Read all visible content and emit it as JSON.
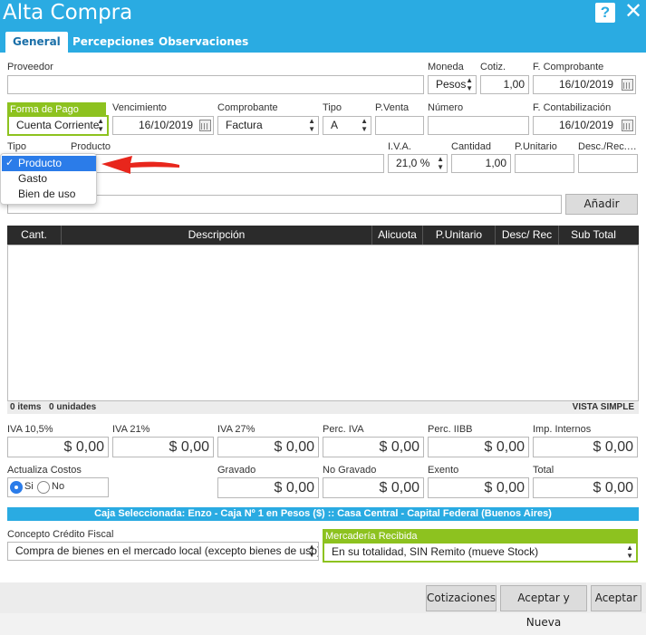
{
  "window": {
    "title": "Alta Compra",
    "help": "?",
    "close": "✕"
  },
  "tabs": [
    {
      "label": "General"
    },
    {
      "label": "Percepciones"
    },
    {
      "label": "Observaciones"
    }
  ],
  "row1": {
    "proveedor_label": "Proveedor",
    "moneda_label": "Moneda",
    "moneda_value": "Pesos",
    "cotiz_label": "Cotiz.",
    "cotiz_value": "1,00",
    "fcomp_label": "F. Comprobante",
    "fcomp_value": "16/10/2019"
  },
  "row2": {
    "forma_pago_label": "Forma de Pago",
    "forma_pago_value": "Cuenta Corriente",
    "vencimiento_label": "Vencimiento",
    "vencimiento_value": "16/10/2019",
    "comprobante_label": "Comprobante",
    "comprobante_value": "Factura",
    "tipo_label": "Tipo",
    "tipo_value": "A",
    "pventa_label": "P.Venta",
    "numero_label": "Número",
    "fcontab_label": "F. Contabilización",
    "fcontab_value": "16/10/2019"
  },
  "row3": {
    "tipo_label": "Tipo",
    "producto_label": "Producto",
    "iva_label": "I.V.A.",
    "iva_value": "21,0 %",
    "cantidad_label": "Cantidad",
    "cantidad_value": "1,00",
    "punitario_label": "P.Unitario",
    "descrec_label": "Desc./Rec.…"
  },
  "tipo_dropdown": {
    "options": [
      "Producto",
      "Gasto",
      "Bien de uso"
    ],
    "selected": "Producto",
    "check": "✓"
  },
  "add_button": "Añadir",
  "table": {
    "columns": [
      "Cant.",
      "Descripción",
      "Alicuota",
      "P.Unitario",
      "Desc/ Rec",
      "Sub Total"
    ],
    "footer_items": "0 items",
    "footer_units": "0 unidades",
    "view_mode": "VISTA SIMPLE"
  },
  "totals1": [
    {
      "label": "IVA 10,5%",
      "value": "$ 0,00"
    },
    {
      "label": "IVA 21%",
      "value": "$ 0,00"
    },
    {
      "label": "IVA 27%",
      "value": "$ 0,00"
    },
    {
      "label": "Perc. IVA",
      "value": "$ 0,00"
    },
    {
      "label": "Perc. IIBB",
      "value": "$ 0,00"
    },
    {
      "label": "Imp. Internos",
      "value": "$ 0,00"
    }
  ],
  "totals2": {
    "actualiza_label": "Actualiza Costos",
    "si_label": "Si",
    "no_label": "No",
    "items": [
      {
        "label": "Gravado",
        "value": "$ 0,00"
      },
      {
        "label": "No Gravado",
        "value": "$ 0,00"
      },
      {
        "label": "Exento",
        "value": "$ 0,00"
      },
      {
        "label": "Total",
        "value": "$ 0,00"
      }
    ]
  },
  "caja_text": "Caja Seleccionada: Enzo - Caja Nº 1 en Pesos ($) :: Casa Central - Capital Federal (Buenos Aires)",
  "concepto": {
    "label": "Concepto Crédito Fiscal",
    "value": "Compra de bienes en el mercado local (excepto bienes de uso)"
  },
  "mercaderia": {
    "label": "Mercadería Recibida",
    "value": "En su totalidad, SIN Remito (mueve Stock)"
  },
  "buttons": {
    "cotizaciones": "Cotizaciones",
    "aceptar_nueva": "Aceptar y Nueva",
    "aceptar": "Aceptar"
  },
  "colors": {
    "header": "#2aabe2",
    "green": "#8dc21f",
    "highlight": "#2b7ce9",
    "annotation": "#e8261c"
  }
}
